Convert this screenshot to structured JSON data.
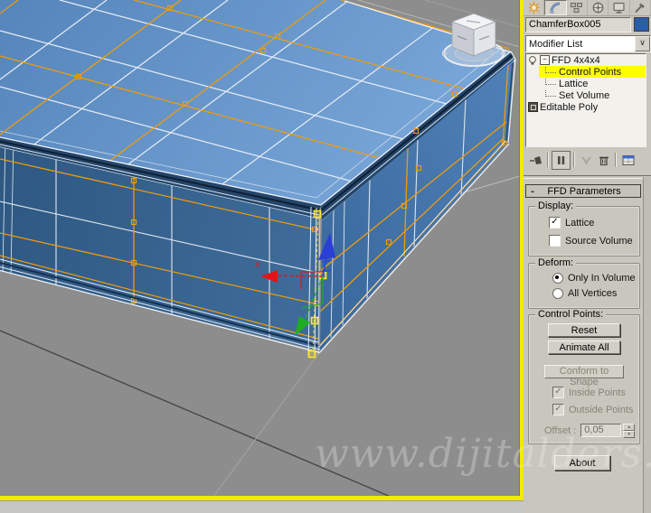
{
  "watermark": {
    "text": "www.dijitalders.com"
  },
  "command_panel": {
    "tabs": [
      {
        "name": "create"
      },
      {
        "name": "modify",
        "active": true
      },
      {
        "name": "hierarchy"
      },
      {
        "name": "motion"
      },
      {
        "name": "display"
      },
      {
        "name": "utilities"
      }
    ],
    "object_name": "ChamferBox005",
    "object_color": "#2a5da8",
    "modifier_list": {
      "label": "Modifier List"
    },
    "modifier_stack": {
      "items": [
        {
          "label": "FFD 4x4x4",
          "type": "modifier",
          "expanded": true,
          "enabled": true
        },
        {
          "label": "Control Points",
          "type": "sub-object",
          "selected": true
        },
        {
          "label": "Lattice",
          "type": "sub-object"
        },
        {
          "label": "Set Volume",
          "type": "sub-object"
        },
        {
          "label": "Editable Poly",
          "type": "base-object"
        }
      ]
    },
    "stack_toolbar": [
      {
        "name": "pin-stack"
      },
      {
        "name": "show-end-result",
        "framed": true
      },
      {
        "name": "make-unique",
        "disabled": true
      },
      {
        "name": "remove-modifier"
      },
      {
        "name": "configure-modifier-sets"
      }
    ],
    "rollout": {
      "title": "FFD Parameters",
      "collapse_glyph": "-",
      "display_group": {
        "label": "Display:",
        "lattice": {
          "label": "Lattice",
          "checked": true
        },
        "source_volume": {
          "label": "Source Volume",
          "checked": false
        }
      },
      "deform_group": {
        "label": "Deform:",
        "only_in_volume": {
          "label": "Only In Volume",
          "selected": true
        },
        "all_vertices": {
          "label": "All Vertices",
          "selected": false
        }
      },
      "control_points_group": {
        "label": "Control Points:",
        "reset": "Reset",
        "animate_all": "Animate All",
        "conform_to_shape": "Conform to Shape",
        "inside_points": {
          "label": "Inside Points",
          "checked": true,
          "disabled": true
        },
        "outside_points": {
          "label": "Outside Points",
          "checked": true,
          "disabled": true
        },
        "offset_label": "Offset :",
        "offset_value": "0,05"
      },
      "about": "About"
    }
  },
  "viewport": {
    "content": "ChamferBox slab with FFD 4x4x4 lattice, Control Points sub-object active, move gizmo on selected corner point",
    "gizmo": {
      "x_label": "x",
      "axis_colors": {
        "x": "#e51414",
        "y": "#1fae1f",
        "z": "#2b3fd6"
      }
    },
    "colors": {
      "ground": "#8d8d8d",
      "top_face": "#6093c8",
      "front_face": "#35608c",
      "right_face": "#4170a6",
      "lattice": "#ef9b0c",
      "selection": "#ffe92b",
      "viewport_border": "#f2ea00"
    }
  }
}
